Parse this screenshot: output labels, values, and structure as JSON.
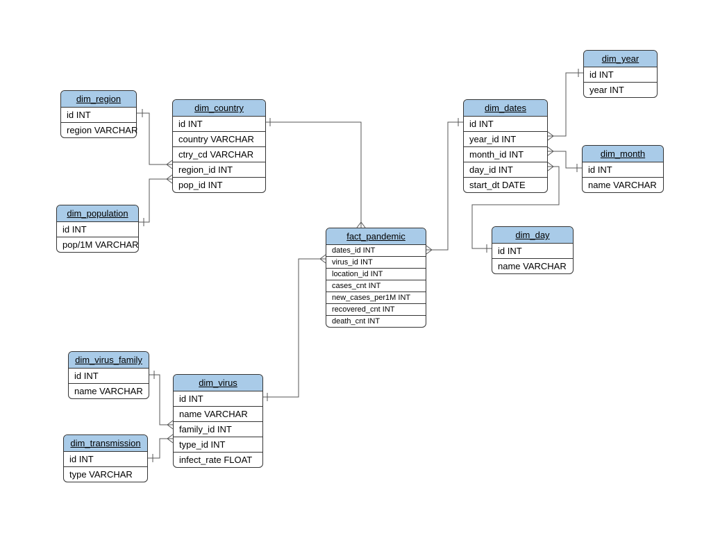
{
  "entities": {
    "dim_region": {
      "title": "dim_region",
      "cols": [
        "id INT",
        "region VARCHAR"
      ]
    },
    "dim_population": {
      "title": "dim_population",
      "cols": [
        "id INT",
        "pop/1M VARCHAR"
      ]
    },
    "dim_country": {
      "title": "dim_country",
      "cols": [
        "id INT",
        "country VARCHAR",
        "ctry_cd VARCHAR",
        "region_id INT",
        "pop_id INT"
      ]
    },
    "fact_pandemic": {
      "title": "fact_pandemic",
      "cols": [
        "dates_id INT",
        "virus_id INT",
        "location_id INT",
        "cases_cnt INT",
        "new_cases_per1M INT",
        "recovered_cnt INT",
        "death_cnt INT"
      ]
    },
    "dim_dates": {
      "title": "dim_dates",
      "cols": [
        "id INT",
        "year_id INT",
        "month_id INT",
        "day_id INT",
        "start_dt DATE"
      ]
    },
    "dim_year": {
      "title": "dim_year",
      "cols": [
        "id INT",
        "year INT"
      ]
    },
    "dim_month": {
      "title": "dim_month",
      "cols": [
        "id INT",
        "name VARCHAR"
      ]
    },
    "dim_day": {
      "title": "dim_day",
      "cols": [
        "id INT",
        "name VARCHAR"
      ]
    },
    "dim_virus": {
      "title": "dim_virus",
      "cols": [
        "id INT",
        "name VARCHAR",
        "family_id INT",
        "type_id INT",
        "infect_rate FLOAT"
      ]
    },
    "dim_virus_family": {
      "title": "dim_virus_family",
      "cols": [
        "id INT",
        "name VARCHAR"
      ]
    },
    "dim_transmission": {
      "title": "dim_transmission",
      "cols": [
        "id INT",
        "type VARCHAR"
      ]
    }
  }
}
